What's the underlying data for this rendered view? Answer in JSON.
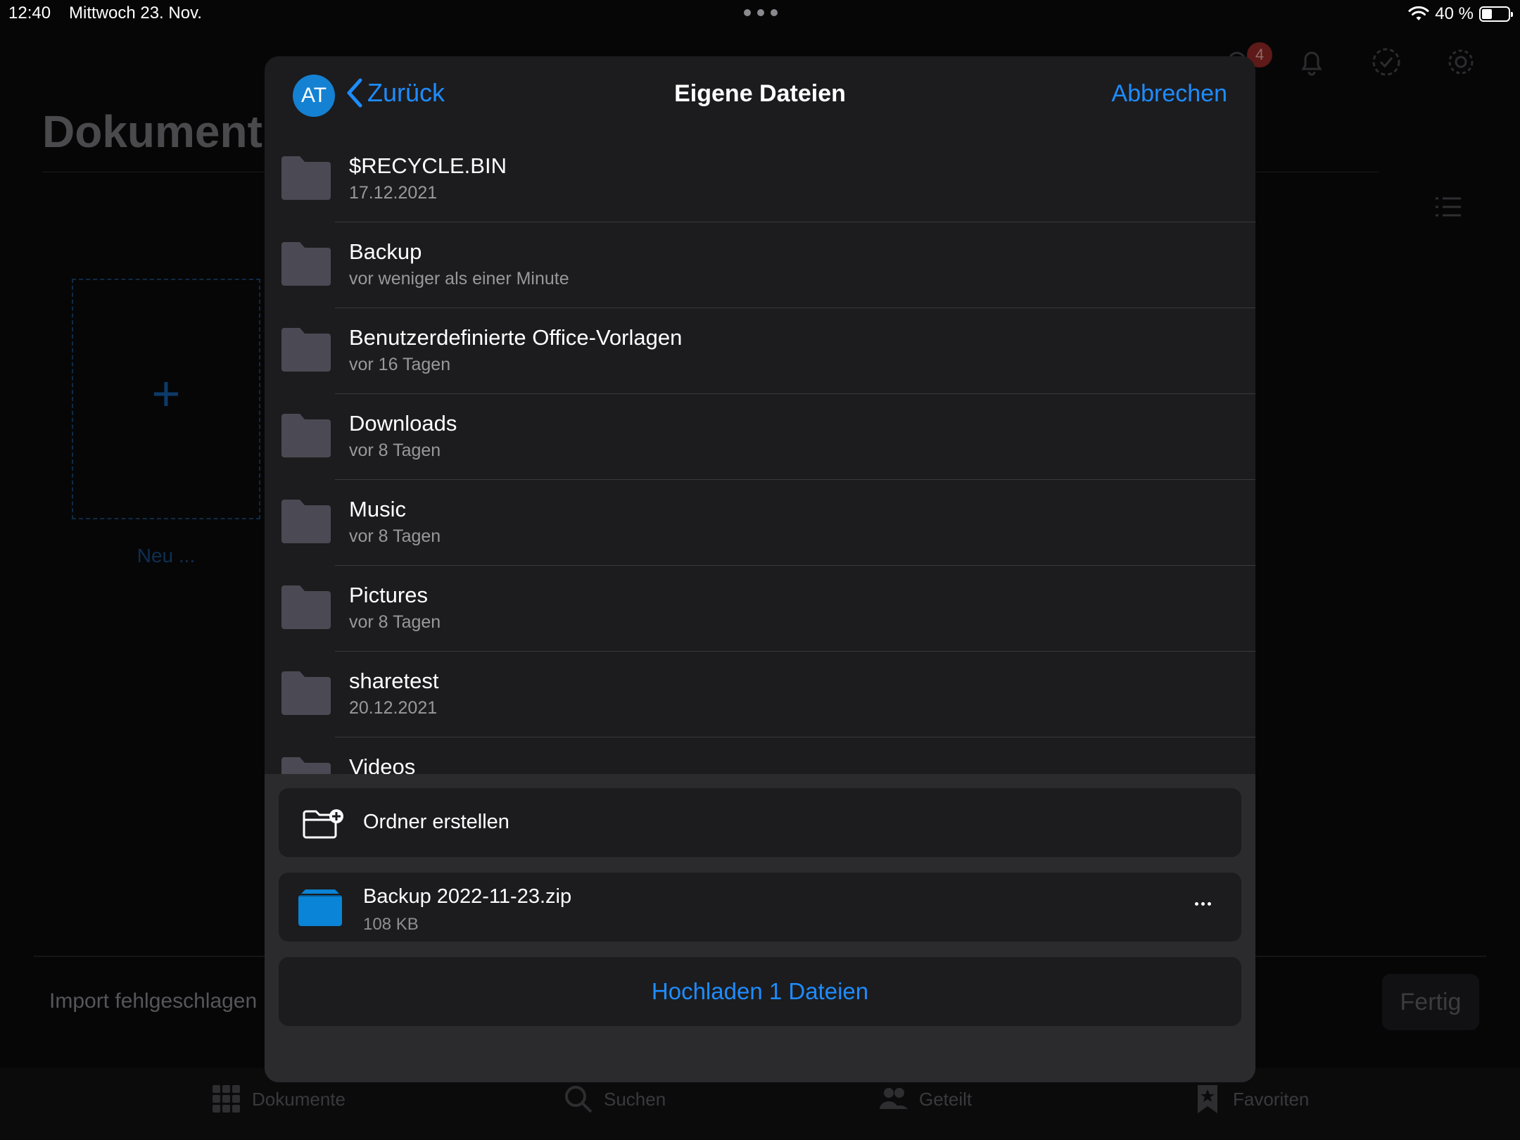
{
  "status_bar": {
    "time": "12:40",
    "date": "Mittwoch 23. Nov.",
    "battery": "40 %"
  },
  "background": {
    "page_title": "Dokument",
    "notification_count": "4",
    "new_label": "Neu ...",
    "plus": "+",
    "import_status": "Import fehlgeschlagen",
    "done_label": "Fertig",
    "tabs": [
      {
        "label": "Dokumente",
        "icon": "grid-icon"
      },
      {
        "label": "Suchen",
        "icon": "search-icon"
      },
      {
        "label": "Geteilt",
        "icon": "people-icon"
      },
      {
        "label": "Favoriten",
        "icon": "bookmark-star-icon"
      }
    ]
  },
  "sheet": {
    "avatar_initials": "AT",
    "back_label": "Zurück",
    "title": "Eigene Dateien",
    "cancel_label": "Abbrechen",
    "folders": [
      {
        "name": "$RECYCLE.BIN",
        "date": "17.12.2021"
      },
      {
        "name": "Backup",
        "date": "vor weniger als einer Minute"
      },
      {
        "name": "Benutzerdefinierte Office-Vorlagen",
        "date": "vor 16 Tagen"
      },
      {
        "name": "Downloads",
        "date": "vor 8 Tagen"
      },
      {
        "name": "Music",
        "date": "vor 8 Tagen"
      },
      {
        "name": "Pictures",
        "date": "vor 8 Tagen"
      },
      {
        "name": "sharetest",
        "date": "20.12.2021"
      },
      {
        "name": "Videos",
        "date": ""
      }
    ],
    "create_folder_label": "Ordner erstellen",
    "file": {
      "name": "Backup 2022-11-23.zip",
      "size": "108 KB"
    },
    "upload_label": "Hochladen 1 Dateien"
  },
  "colors": {
    "accent": "#1e8cff",
    "avatar": "#1481d3",
    "sheet_bg": "#1c1c1e",
    "folder": "#4b4a54",
    "zip": "#0a84d6"
  }
}
